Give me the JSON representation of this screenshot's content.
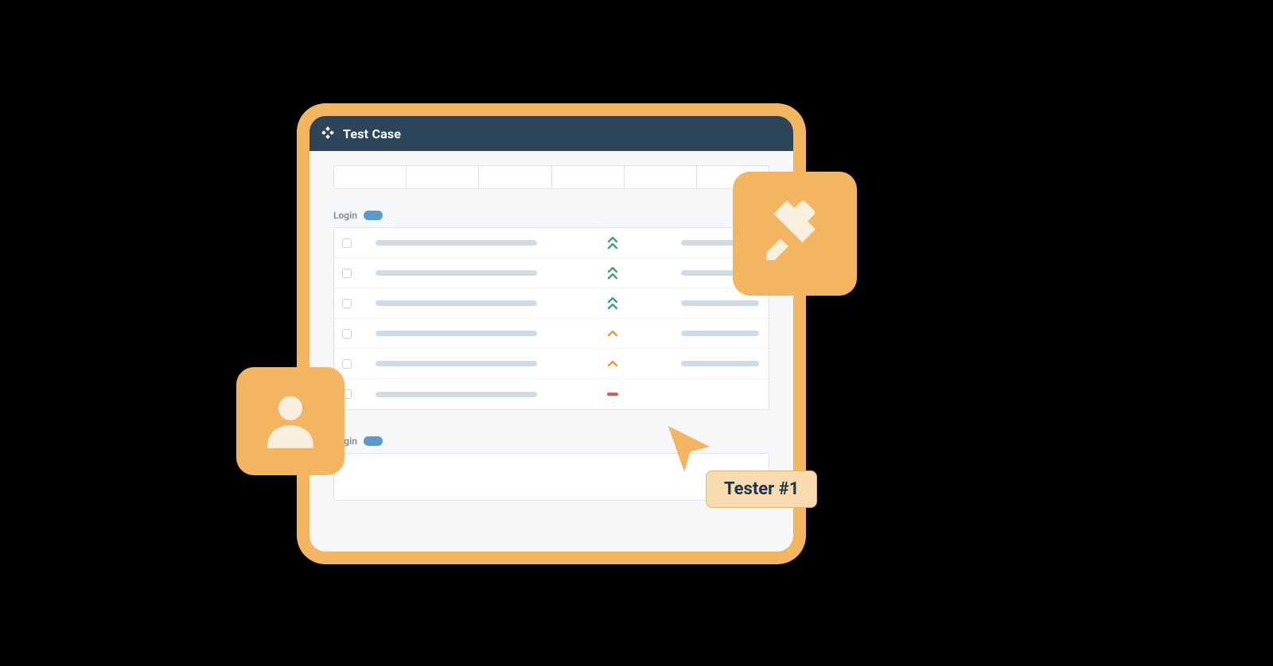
{
  "titlebar": {
    "title": "Test Case"
  },
  "sections": [
    {
      "label": "Login"
    },
    {
      "label": "Login"
    }
  ],
  "rows": [
    {
      "priority": "high",
      "color": "#3fa36b"
    },
    {
      "priority": "high",
      "color": "#3fa36b"
    },
    {
      "priority": "high",
      "color": "#3fa36b"
    },
    {
      "priority": "medium",
      "color": "#e79a2f"
    },
    {
      "priority": "medium",
      "color": "#e79a2f"
    },
    {
      "priority": "low",
      "color": "#e15a4a"
    }
  ],
  "tabs_count": 6,
  "badge": {
    "text": "Tester #1"
  },
  "icons": {
    "logo": "diamond-cluster-icon",
    "user": "user-icon",
    "edit": "pencil-icon",
    "cursor": "cursor-icon"
  },
  "colors": {
    "frame": "#f3b560",
    "header": "#2d4558",
    "placeholder": "#cfdce5",
    "high": "#3fa36b",
    "medium": "#e79a2f",
    "low": "#e15a4a",
    "badge_bg": "#f9dbb0",
    "badge_border": "#e6b46a",
    "cream": "#f8efe0"
  }
}
